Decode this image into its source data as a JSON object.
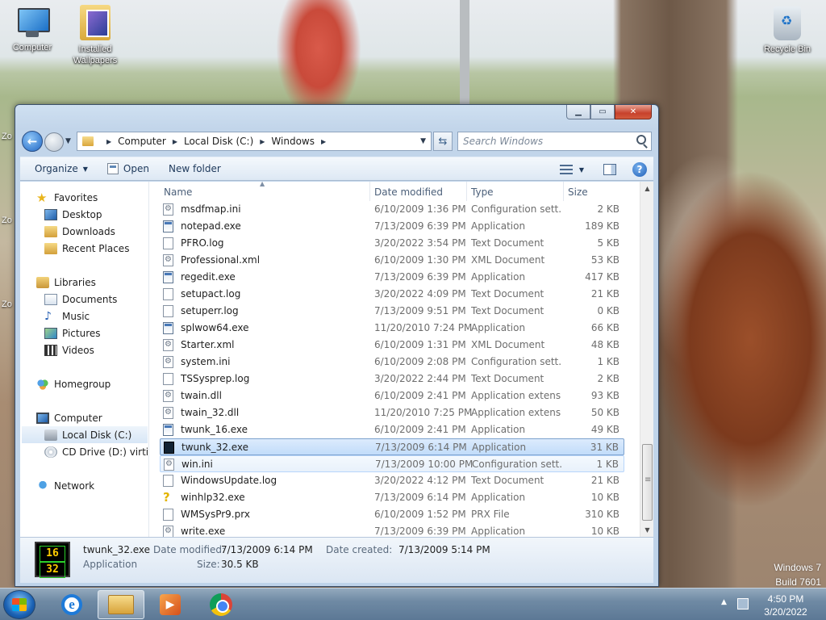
{
  "desktop": {
    "icons": [
      {
        "label": "Computer",
        "icon": "computer-icon"
      },
      {
        "label": "Installed Wallpapers",
        "icon": "folder-icon"
      },
      {
        "label": "Recycle Bin",
        "icon": "recycle-bin-icon"
      }
    ],
    "edge_labels": [
      "Zo",
      "Zo",
      "Zo"
    ],
    "watermark": {
      "line1": "Windows 7",
      "line2": "Build 7601"
    }
  },
  "window": {
    "breadcrumbs": [
      "Computer",
      "Local Disk (C:)",
      "Windows"
    ],
    "search_placeholder": "Search Windows",
    "toolbar": {
      "organize": "Organize",
      "open": "Open",
      "new_folder": "New folder"
    },
    "nav": {
      "favorites": "Favorites",
      "desktop": "Desktop",
      "downloads": "Downloads",
      "recent_places": "Recent Places",
      "libraries": "Libraries",
      "documents": "Documents",
      "music": "Music",
      "pictures": "Pictures",
      "videos": "Videos",
      "homegroup": "Homegroup",
      "computer": "Computer",
      "local_disk": "Local Disk (C:)",
      "cd_drive": "CD Drive (D:) virtio-w",
      "network": "Network"
    },
    "columns": {
      "name": "Name",
      "date": "Date modified",
      "type": "Type",
      "size": "Size"
    },
    "files": [
      {
        "name": "msdfmap.ini",
        "date": "6/10/2009 1:36 PM",
        "type": "Configuration sett...",
        "size": "2 KB",
        "kind": "cfg"
      },
      {
        "name": "notepad.exe",
        "date": "7/13/2009 6:39 PM",
        "type": "Application",
        "size": "189 KB",
        "kind": "exe"
      },
      {
        "name": "PFRO.log",
        "date": "3/20/2022 3:54 PM",
        "type": "Text Document",
        "size": "5 KB",
        "kind": "doc"
      },
      {
        "name": "Professional.xml",
        "date": "6/10/2009 1:30 PM",
        "type": "XML Document",
        "size": "53 KB",
        "kind": "cfg"
      },
      {
        "name": "regedit.exe",
        "date": "7/13/2009 6:39 PM",
        "type": "Application",
        "size": "417 KB",
        "kind": "exe"
      },
      {
        "name": "setupact.log",
        "date": "3/20/2022 4:09 PM",
        "type": "Text Document",
        "size": "21 KB",
        "kind": "doc"
      },
      {
        "name": "setuperr.log",
        "date": "7/13/2009 9:51 PM",
        "type": "Text Document",
        "size": "0 KB",
        "kind": "doc"
      },
      {
        "name": "splwow64.exe",
        "date": "11/20/2010 7:24 PM",
        "type": "Application",
        "size": "66 KB",
        "kind": "exe"
      },
      {
        "name": "Starter.xml",
        "date": "6/10/2009 1:31 PM",
        "type": "XML Document",
        "size": "48 KB",
        "kind": "cfg"
      },
      {
        "name": "system.ini",
        "date": "6/10/2009 2:08 PM",
        "type": "Configuration sett...",
        "size": "1 KB",
        "kind": "cfg"
      },
      {
        "name": "TSSysprep.log",
        "date": "3/20/2022 2:44 PM",
        "type": "Text Document",
        "size": "2 KB",
        "kind": "doc"
      },
      {
        "name": "twain.dll",
        "date": "6/10/2009 2:41 PM",
        "type": "Application extens...",
        "size": "93 KB",
        "kind": "cfg"
      },
      {
        "name": "twain_32.dll",
        "date": "11/20/2010 7:25 PM",
        "type": "Application extens...",
        "size": "50 KB",
        "kind": "cfg"
      },
      {
        "name": "twunk_16.exe",
        "date": "6/10/2009 2:41 PM",
        "type": "Application",
        "size": "49 KB",
        "kind": "exe"
      },
      {
        "name": "twunk_32.exe",
        "date": "7/13/2009 6:14 PM",
        "type": "Application",
        "size": "31 KB",
        "kind": "special"
      },
      {
        "name": "win.ini",
        "date": "7/13/2009 10:00 PM",
        "type": "Configuration sett...",
        "size": "1 KB",
        "kind": "cfg"
      },
      {
        "name": "WindowsUpdate.log",
        "date": "3/20/2022 4:12 PM",
        "type": "Text Document",
        "size": "21 KB",
        "kind": "doc"
      },
      {
        "name": "winhlp32.exe",
        "date": "7/13/2009 6:14 PM",
        "type": "Application",
        "size": "10 KB",
        "kind": "help"
      },
      {
        "name": "WMSysPr9.prx",
        "date": "6/10/2009 1:52 PM",
        "type": "PRX File",
        "size": "310 KB",
        "kind": "doc"
      },
      {
        "name": "write.exe",
        "date": "7/13/2009 6:39 PM",
        "type": "Application",
        "size": "10 KB",
        "kind": "cfg"
      }
    ],
    "selected_file": "twunk_32.exe",
    "hovered_file": "win.ini",
    "details": {
      "name": "twunk_32.exe",
      "type": "Application",
      "icon_top": "16",
      "icon_bottom": "32",
      "date_modified_label": "Date modified:",
      "date_modified": "7/13/2009 6:14 PM",
      "date_created_label": "Date created:",
      "date_created": "7/13/2009 5:14 PM",
      "size_label": "Size:",
      "size": "30.5 KB"
    }
  },
  "taskbar": {
    "ie_letter": "e",
    "clock_time": "4:50 PM",
    "clock_date": "3/20/2022"
  }
}
